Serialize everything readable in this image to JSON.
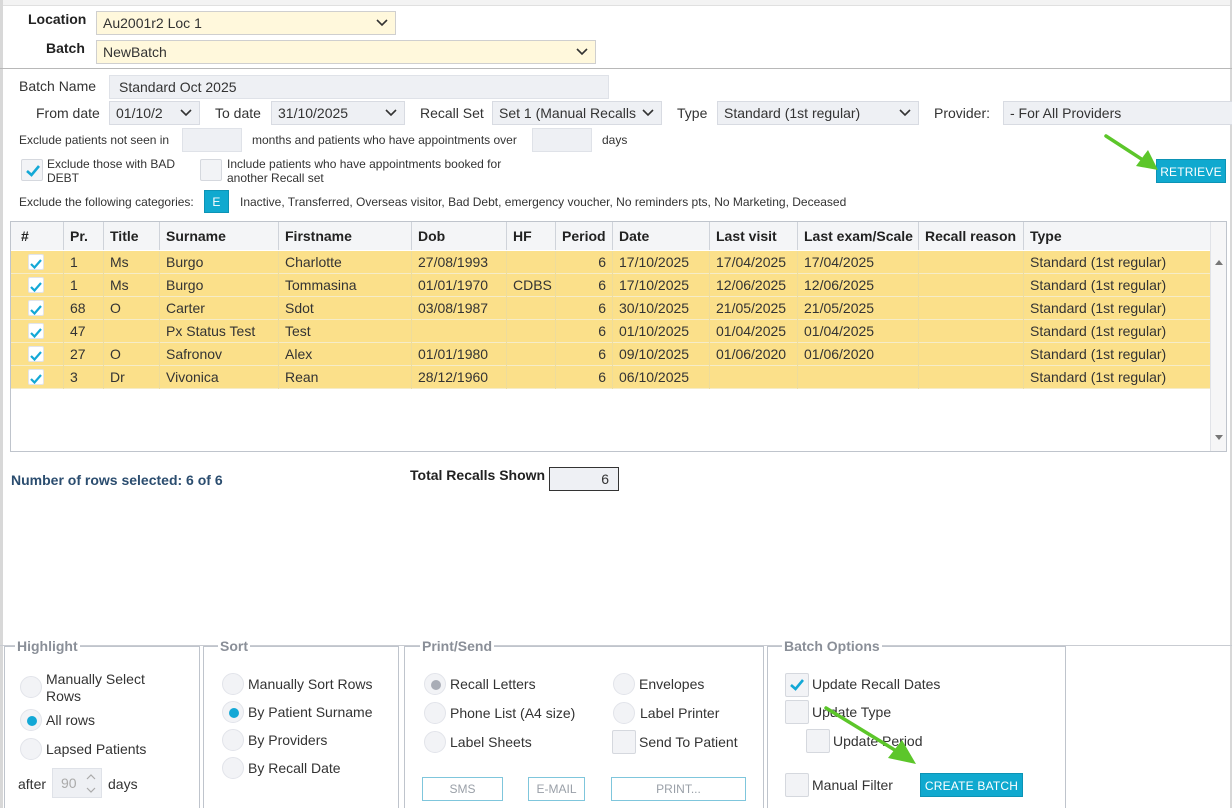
{
  "top": {
    "location_label": "Location",
    "location_value": "Au2001r2 Loc 1",
    "batch_label": "Batch",
    "batch_value": "NewBatch"
  },
  "filters": {
    "batch_name_label": "Batch Name",
    "batch_name_value": "Standard Oct 2025",
    "from_label": "From date",
    "from_value": "01/10/2",
    "to_label": "To date",
    "to_value": "31/10/2025",
    "recall_set_label": "Recall Set",
    "recall_set_value": "Set 1 (Manual Recalls",
    "type_label": "Type",
    "type_value": "Standard (1st regular)",
    "provider_label": "Provider:",
    "provider_value": "- For All Providers",
    "exclude_not_seen": "Exclude patients not seen in",
    "months_text": "months and patients who have appointments over",
    "days_text": "days",
    "bad_debt_label": "Exclude those with BAD DEBT",
    "include_booked_label": "Include patients who have appointments booked for another Recall set",
    "retrieve": "RETRIEVE",
    "exclude_categories_label": "Exclude the following categories:",
    "categories_button": "E",
    "categories_text": "Inactive, Transferred, Overseas visitor, Bad Debt, emergency voucher, No reminders pts, No Marketing, Deceased"
  },
  "table": {
    "headers": [
      "#",
      "Pr.",
      "Title",
      "Surname",
      "Firstname",
      "Dob",
      "HF",
      "Period",
      "Date",
      "Last visit",
      "Last exam/Scale",
      "Recall reason",
      "Type"
    ],
    "rows": [
      [
        "",
        "1",
        "Ms",
        "Burgo",
        "Charlotte",
        "27/08/1993",
        "",
        "6",
        "17/10/2025",
        "17/04/2025",
        "17/04/2025",
        "",
        "Standard (1st regular)"
      ],
      [
        "",
        "1",
        "Ms",
        "Burgo",
        "Tommasina",
        "01/01/1970",
        "CDBS",
        "6",
        "17/10/2025",
        "12/06/2025",
        "12/06/2025",
        "",
        "Standard (1st regular)"
      ],
      [
        "",
        "68",
        "O",
        "Carter",
        "Sdot",
        "03/08/1987",
        "",
        "6",
        "30/10/2025",
        "21/05/2025",
        "21/05/2025",
        "",
        "Standard (1st regular)"
      ],
      [
        "",
        "47",
        "",
        "Px Status Test",
        "Test",
        "",
        "",
        "6",
        "01/10/2025",
        "01/04/2025",
        "01/04/2025",
        "",
        "Standard (1st regular)"
      ],
      [
        "",
        "27",
        "O",
        "Safronov",
        "Alex",
        "01/01/1980",
        "",
        "6",
        "09/10/2025",
        "01/06/2020",
        "01/06/2020",
        "",
        "Standard (1st regular)"
      ],
      [
        "",
        "3",
        "Dr",
        "Vivonica",
        "Rean",
        "28/12/1960",
        "",
        "6",
        "06/10/2025",
        "",
        "",
        "",
        "Standard (1st regular)"
      ]
    ]
  },
  "summary": {
    "rows_selected": "Number of rows selected: 6 of 6",
    "total_label": "Total Recalls Shown",
    "total_value": "6"
  },
  "highlight": {
    "legend": "Highlight",
    "manual": "Manually Select Rows",
    "all": "All rows",
    "lapsed": "Lapsed Patients",
    "after": "after",
    "after_value": "90",
    "days": "days"
  },
  "sort": {
    "legend": "Sort",
    "manual": "Manually Sort Rows",
    "surname": "By Patient Surname",
    "providers": "By Providers",
    "recall_date": "By Recall Date"
  },
  "print": {
    "legend": "Print/Send",
    "recall_letters": "Recall Letters",
    "phone_list": "Phone List (A4 size)",
    "label_sheets": "Label Sheets",
    "envelopes": "Envelopes",
    "label_printer": "Label Printer",
    "send_to_patient": "Send To Patient",
    "sms": "SMS",
    "email": "E-MAIL",
    "print": "PRINT..."
  },
  "batch_options": {
    "legend": "Batch Options",
    "update_recall_dates": "Update Recall Dates",
    "update_type": "Update Type",
    "update_period": "Update Period",
    "manual_filter": "Manual Filter",
    "create_batch": "CREATE BATCH"
  },
  "colors": {
    "accent": "#10a9cf",
    "row_selected": "#fbe08a",
    "annotation_arrow": "#5cc62a"
  }
}
